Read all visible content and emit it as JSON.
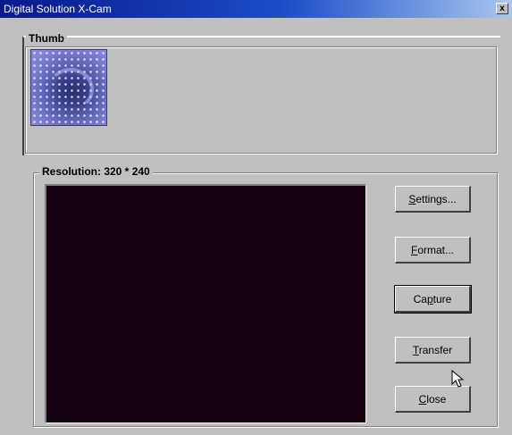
{
  "window": {
    "title": "Digital Solution X-Cam",
    "close_label": "x"
  },
  "thumb_group": {
    "label": "Thumb"
  },
  "preview_group": {
    "label": "Resolution:  320 * 240"
  },
  "buttons": [
    {
      "label": "Settings...",
      "accel": "S",
      "rest": "ettings..."
    },
    {
      "label": "Format...",
      "accel": "F",
      "rest": "ormat..."
    },
    {
      "label": "Capture",
      "pre": "Ca",
      "accel": "p",
      "rest": "ture"
    },
    {
      "label": "Transfer",
      "accel": "T",
      "rest": "ransfer"
    },
    {
      "label": "Close",
      "accel": "C",
      "rest": "lose"
    }
  ],
  "colors": {
    "titlebar_start": "#0a1a8c",
    "titlebar_end": "#a6c8f0",
    "preview_bg": "#150012",
    "face": "#c0c0c0"
  },
  "icons": {
    "close": "close-icon",
    "cursor": "arrow-cursor-icon"
  }
}
